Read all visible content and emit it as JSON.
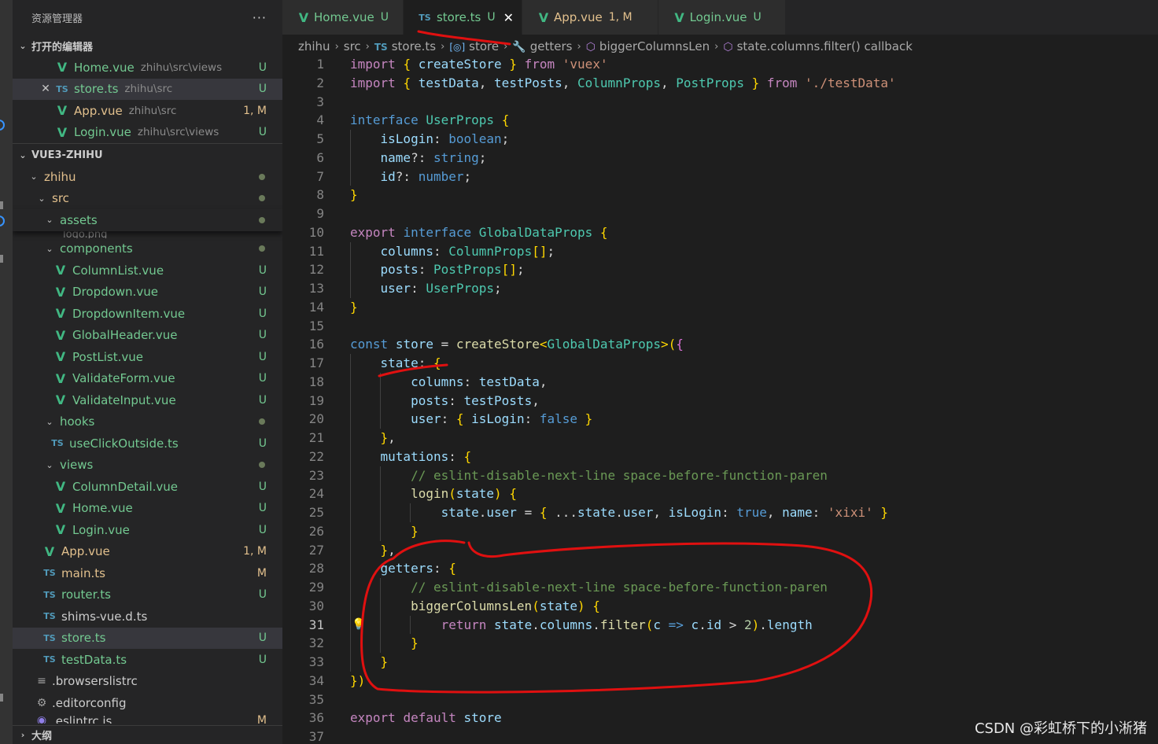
{
  "explorer": {
    "title": "资源管理器",
    "more": "···",
    "open_editors_title": "打开的编辑器",
    "open_editors": [
      {
        "name": "Home.vue",
        "path": "zhihu\\src\\views",
        "status": "U",
        "icon": "vue-icon"
      },
      {
        "name": "store.ts",
        "path": "zhihu\\src",
        "status": "U",
        "icon": "ts-icon"
      },
      {
        "name": "App.vue",
        "path": "zhihu\\src",
        "status": "1, M",
        "icon": "vue-icon"
      },
      {
        "name": "Login.vue",
        "path": "zhihu\\src\\views",
        "status": "U",
        "icon": "vue-icon"
      }
    ],
    "project_title": "VUE3-ZHIHU",
    "tree": {
      "zhihu": "zhihu",
      "src": "src",
      "assets": "assets",
      "logo": "logo.png",
      "components": "components",
      "component_files": [
        {
          "name": "ColumnList.vue",
          "status": "U"
        },
        {
          "name": "Dropdown.vue",
          "status": "U"
        },
        {
          "name": "DropdownItem.vue",
          "status": "U"
        },
        {
          "name": "GlobalHeader.vue",
          "status": "U"
        },
        {
          "name": "PostList.vue",
          "status": "U"
        },
        {
          "name": "ValidateForm.vue",
          "status": "U"
        },
        {
          "name": "ValidateInput.vue",
          "status": "U"
        }
      ],
      "hooks": "hooks",
      "hooks_files": [
        {
          "name": "useClickOutside.ts",
          "status": "U"
        }
      ],
      "views": "views",
      "views_files": [
        {
          "name": "ColumnDetail.vue",
          "status": "U"
        },
        {
          "name": "Home.vue",
          "status": "U"
        },
        {
          "name": "Login.vue",
          "status": "U"
        }
      ],
      "src_files": [
        {
          "name": "App.vue",
          "status": "1, M",
          "kind": "vue"
        },
        {
          "name": "main.ts",
          "status": "M",
          "kind": "ts"
        },
        {
          "name": "router.ts",
          "status": "U",
          "kind": "ts"
        },
        {
          "name": "shims-vue.d.ts",
          "status": "",
          "kind": "ts"
        },
        {
          "name": "store.ts",
          "status": "U",
          "kind": "ts"
        },
        {
          "name": "testData.ts",
          "status": "U",
          "kind": "ts"
        }
      ],
      "root_files": [
        {
          "name": ".browserslistrc",
          "status": "",
          "icon": "list-icon"
        },
        {
          "name": ".editorconfig",
          "status": "",
          "icon": "gear-icon"
        },
        {
          "name": ".eslintrc.js",
          "status": "M",
          "icon": "eslint-icon"
        }
      ]
    },
    "outline_title": "大纲"
  },
  "tabs": [
    {
      "name": "Home.vue",
      "status": "U",
      "icon": "vue-icon",
      "active": false
    },
    {
      "name": "store.ts",
      "status": "U",
      "icon": "ts-icon",
      "active": true
    },
    {
      "name": "App.vue",
      "status": "1, M",
      "icon": "vue-icon",
      "active": false
    },
    {
      "name": "Login.vue",
      "status": "U",
      "icon": "vue-icon",
      "active": false
    }
  ],
  "breadcrumb": [
    "zhihu",
    "src",
    "store.ts",
    "store",
    "getters",
    "biggerColumnsLen",
    "state.columns.filter() callback"
  ],
  "editor": {
    "current_line": 31,
    "lines": [
      "import { createStore } from 'vuex'",
      "import { testData, testPosts, ColumnProps, PostProps } from './testData'",
      "",
      "interface UserProps {",
      "  isLogin: boolean;",
      "  name?: string;",
      "  id?: number;",
      "}",
      "",
      "export interface GlobalDataProps {",
      "  columns: ColumnProps[];",
      "  posts: PostProps[];",
      "  user: UserProps;",
      "}",
      "",
      "const store = createStore<GlobalDataProps>({",
      "  state: {",
      "    columns: testData,",
      "    posts: testPosts,",
      "    user: { isLogin: false }",
      "  },",
      "  mutations: {",
      "    // eslint-disable-next-line space-before-function-paren",
      "    login(state) {",
      "      state.user = { ...state.user, isLogin: true, name: 'xixi' }",
      "    }",
      "  },",
      "  getters: {",
      "    // eslint-disable-next-line space-before-function-paren",
      "    biggerColumnsLen(state) {",
      "      return state.columns.filter(c => c.id > 2).length",
      "    }",
      "  }",
      "})",
      "",
      "export default store",
      ""
    ]
  },
  "watermark": "CSDN @彩虹桥下的小淅猪",
  "colors": {
    "annotation": "#e01010",
    "accent": "#0e639c"
  }
}
